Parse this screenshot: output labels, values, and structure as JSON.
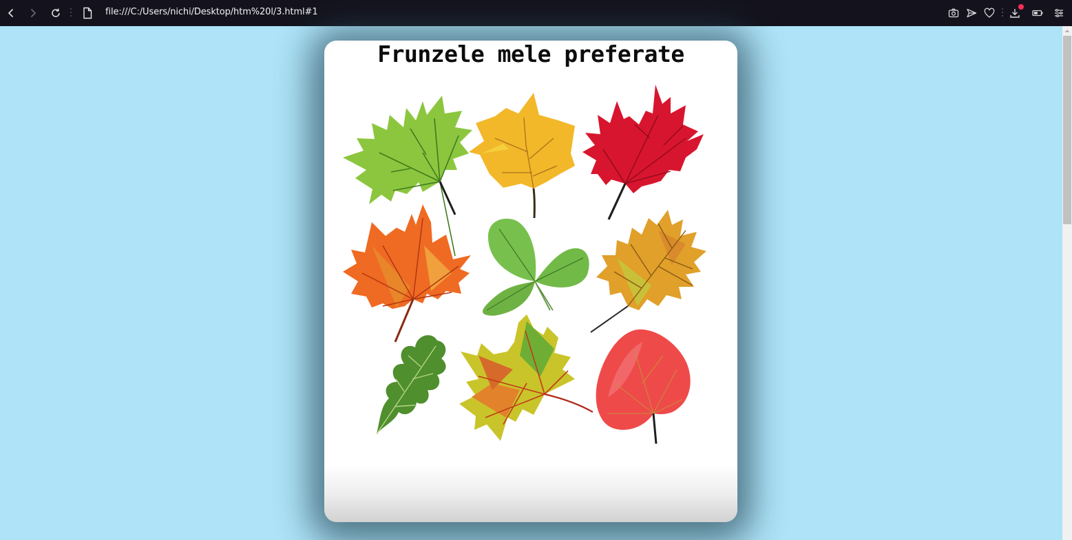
{
  "browser": {
    "url": "file:///C:/Users/nichi/Desktop/htm%20l/3.html#1",
    "icons": {
      "back": "chevron-left-icon",
      "forward": "chevron-right-icon",
      "reload": "reload-icon",
      "page": "page-icon",
      "screenshot": "camera-icon",
      "send": "send-icon",
      "favorite": "heart-icon",
      "downloads": "download-icon",
      "battery": "battery-icon",
      "menu": "menu-icon"
    },
    "colors": {
      "bar": "#14131d",
      "badge": "#ff2d55"
    }
  },
  "page": {
    "background": "#aee3f8",
    "title": "Frunzele mele preferate",
    "leaves": [
      {
        "name": "green-maple-leaf",
        "color": "#8cc63f"
      },
      {
        "name": "yellow-leaf",
        "color": "#f2b82a"
      },
      {
        "name": "red-maple-leaf",
        "color": "#d8152e"
      },
      {
        "name": "orange-maple-leaf",
        "color": "#ef6a22"
      },
      {
        "name": "green-trifoliate-leaf",
        "color": "#6fbf45"
      },
      {
        "name": "orange-oak-leaf",
        "color": "#e0a02a"
      },
      {
        "name": "green-oak-leaf",
        "color": "#4f8f2d"
      },
      {
        "name": "yellow-green-maple-leaf",
        "color": "#c9c42a"
      },
      {
        "name": "red-heart-leaf",
        "color": "#ef4a4a"
      }
    ]
  }
}
